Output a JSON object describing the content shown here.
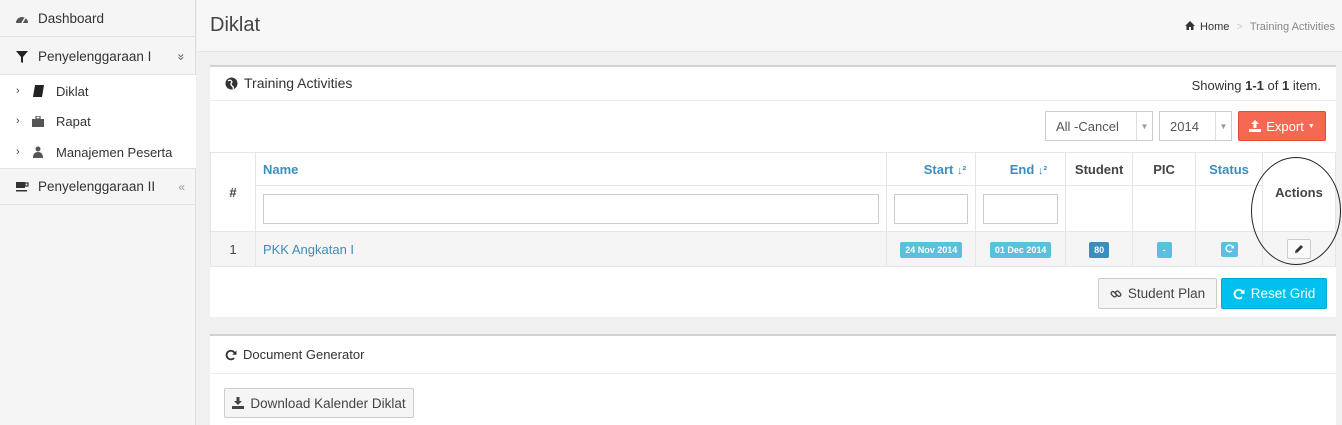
{
  "sidebar": {
    "dashboard": "Dashboard",
    "group1": {
      "label": "Penyelenggaraan I",
      "toggle": "»"
    },
    "subitems": [
      {
        "label": "Diklat",
        "icon": "book-icon"
      },
      {
        "label": "Rapat",
        "icon": "briefcase-icon"
      },
      {
        "label": "Manajemen Peserta",
        "icon": "users-icon"
      }
    ],
    "group2": {
      "label": "Penyelenggaraan II",
      "toggle": "«"
    }
  },
  "header": {
    "title": "Diklat",
    "breadcrumb": {
      "home": "Home",
      "separator": ">",
      "current": "Training Activities"
    }
  },
  "activities": {
    "title": "Training Activities",
    "summary": {
      "prefix": "Showing ",
      "range": "1-1",
      "of": " of ",
      "total": "1",
      "suffix": " item."
    },
    "filter_status": "All -Cancel",
    "filter_year": "2014",
    "export_label": "Export",
    "columns": {
      "num": "#",
      "name": "Name",
      "start": "Start",
      "end": "End",
      "student": "Student",
      "pic": "PIC",
      "status": "Status",
      "actions": "Actions"
    },
    "rows": [
      {
        "num": "1",
        "name": "PKK Angkatan I",
        "start": "24 Nov 2014",
        "end": "01 Dec 2014",
        "student": "80",
        "pic": "-"
      }
    ],
    "student_plan_label": "Student Plan",
    "reset_label": "Reset Grid"
  },
  "document_generator": {
    "title": "Document Generator",
    "download_label": "Download Kalender Diklat"
  },
  "colors": {
    "link": "#3c8dbc",
    "export": "#f56954",
    "reset": "#00c0ef",
    "label_info": "#5bc0de",
    "label_primary": "#3c8dbc"
  }
}
